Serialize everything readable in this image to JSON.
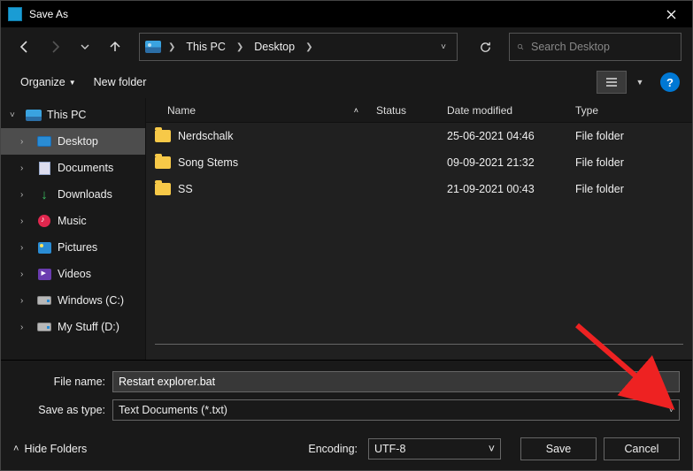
{
  "window": {
    "title": "Save As"
  },
  "nav": {
    "crumbs": [
      "This PC",
      "Desktop"
    ],
    "search_placeholder": "Search Desktop"
  },
  "toolbar": {
    "organize": "Organize",
    "new_folder": "New folder"
  },
  "sidebar": {
    "root": "This PC",
    "items": [
      {
        "label": "Desktop",
        "icon": "desktop",
        "selected": true
      },
      {
        "label": "Documents",
        "icon": "doc"
      },
      {
        "label": "Downloads",
        "icon": "dl"
      },
      {
        "label": "Music",
        "icon": "music"
      },
      {
        "label": "Pictures",
        "icon": "pics"
      },
      {
        "label": "Videos",
        "icon": "vid"
      },
      {
        "label": "Windows (C:)",
        "icon": "drive"
      },
      {
        "label": "My Stuff (D:)",
        "icon": "drive"
      }
    ]
  },
  "columns": {
    "name": "Name",
    "status": "Status",
    "date": "Date modified",
    "type": "Type"
  },
  "files": [
    {
      "name": "Nerdschalk",
      "date": "25-06-2021 04:46",
      "type": "File folder"
    },
    {
      "name": "Song Stems",
      "date": "09-09-2021 21:32",
      "type": "File folder"
    },
    {
      "name": "SS",
      "date": "21-09-2021 00:43",
      "type": "File folder"
    }
  ],
  "form": {
    "filename_label": "File name:",
    "filename_value": "Restart explorer.bat",
    "type_label": "Save as type:",
    "type_value": "Text Documents (*.txt)",
    "encoding_label": "Encoding:",
    "encoding_value": "UTF-8",
    "hide_folders": "Hide Folders",
    "save": "Save",
    "cancel": "Cancel"
  }
}
